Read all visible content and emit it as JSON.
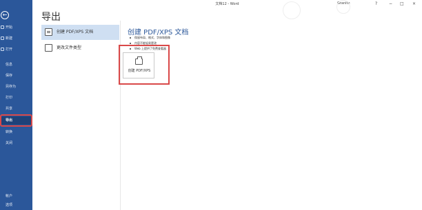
{
  "window": {
    "doc_title": "文档12 - Word",
    "user": "Granite",
    "help": "?",
    "minimize": "−",
    "restore": "□",
    "close": "×"
  },
  "sidebar": {
    "back": "←",
    "items": [
      {
        "label": "开始",
        "icon": "home-icon"
      },
      {
        "label": "新建",
        "icon": "new-doc-icon"
      },
      {
        "label": "打开",
        "icon": "folder-icon"
      },
      {
        "label": "信息",
        "icon": "info-icon"
      },
      {
        "label": "保存",
        "icon": "save-icon"
      },
      {
        "label": "另存为",
        "icon": "save-as-icon"
      },
      {
        "label": "打印",
        "icon": "print-icon"
      },
      {
        "label": "共享",
        "icon": "share-icon"
      },
      {
        "label": "导出",
        "icon": "export-icon",
        "active": true
      },
      {
        "label": "转换",
        "icon": "convert-icon"
      },
      {
        "label": "关闭",
        "icon": "close-doc-icon"
      },
      {
        "label": "帐户",
        "icon": "account-icon"
      },
      {
        "label": "选项",
        "icon": "options-icon"
      }
    ]
  },
  "page": {
    "heading": "导出"
  },
  "options": [
    {
      "label": "创建 PDF/XPS 文档",
      "selected": true
    },
    {
      "label": "更改文件类型",
      "selected": false
    }
  ],
  "detail": {
    "title": "创建 PDF/XPS 文档",
    "bullets": [
      "保留布局、格式、字体和图像",
      "内容不能轻易更改",
      "Web 上提供了免费查看器"
    ],
    "button_label": "创建 PDF/XPS"
  },
  "colors": {
    "sidebar": "#2b579a",
    "accent": "#2b579a",
    "highlight_outline": "#d94848"
  }
}
